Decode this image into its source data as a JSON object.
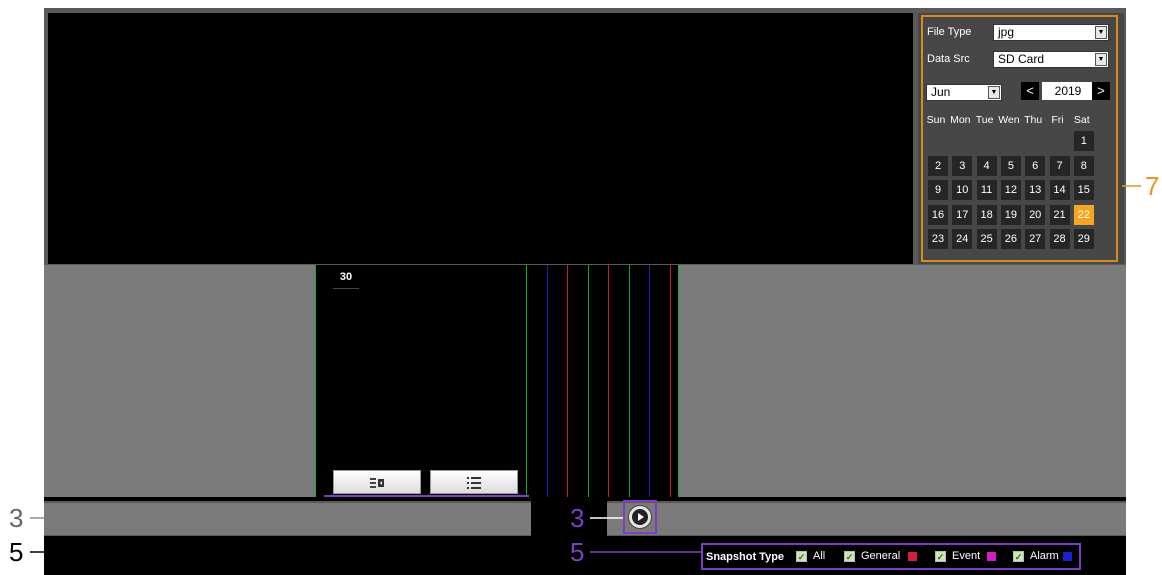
{
  "callouts": {
    "calendar_num": "7",
    "timebar_num_left": "3",
    "timebar_num_mid": "3",
    "snapbar_num_left": "5",
    "snapbar_num_mid": "5"
  },
  "colors": {
    "calendar_callout": "#e8961c",
    "purple_callout": "#7c3fc4",
    "selected_day": "#f5a623"
  },
  "panel": {
    "file_type_label": "File Type",
    "file_type_value": "jpg",
    "data_src_label": "Data Src",
    "data_src_value": "SD Card",
    "month_value": "Jun",
    "year_value": "2019",
    "prev_year": "<",
    "next_year": ">"
  },
  "calendar": {
    "weekdays": [
      "Sun",
      "Mon",
      "Tue",
      "Wen",
      "Thu",
      "Fri",
      "Sat"
    ],
    "weeks": [
      [
        "",
        "",
        "",
        "",
        "",
        "",
        "1"
      ],
      [
        "2",
        "3",
        "4",
        "5",
        "6",
        "7",
        "8"
      ],
      [
        "9",
        "10",
        "11",
        "12",
        "13",
        "14",
        "15"
      ],
      [
        "16",
        "17",
        "18",
        "19",
        "20",
        "21",
        "22"
      ],
      [
        "23",
        "24",
        "25",
        "26",
        "27",
        "28",
        "29"
      ]
    ],
    "selected_day": "22"
  },
  "timeline": {
    "hour_label": "30",
    "marker_colors": [
      "#1fa82a",
      "#1e1ec8",
      "#c8201e",
      "#1fa82a",
      "#c8201e",
      "#1fa82a",
      "#1e1ec8",
      "#c8201e"
    ]
  },
  "toolbar": {
    "export_icon": "export-icon",
    "list_icon": "list-icon",
    "play_icon": "play-icon"
  },
  "snapshot": {
    "label": "Snapshot Type",
    "options": [
      {
        "name": "All",
        "checked": true,
        "color": ""
      },
      {
        "name": "General",
        "checked": true,
        "color": "#d21e3c"
      },
      {
        "name": "Event",
        "checked": true,
        "color": "#d21ec8"
      },
      {
        "name": "Alarm",
        "checked": true,
        "color": "#1e1ed2"
      }
    ]
  }
}
